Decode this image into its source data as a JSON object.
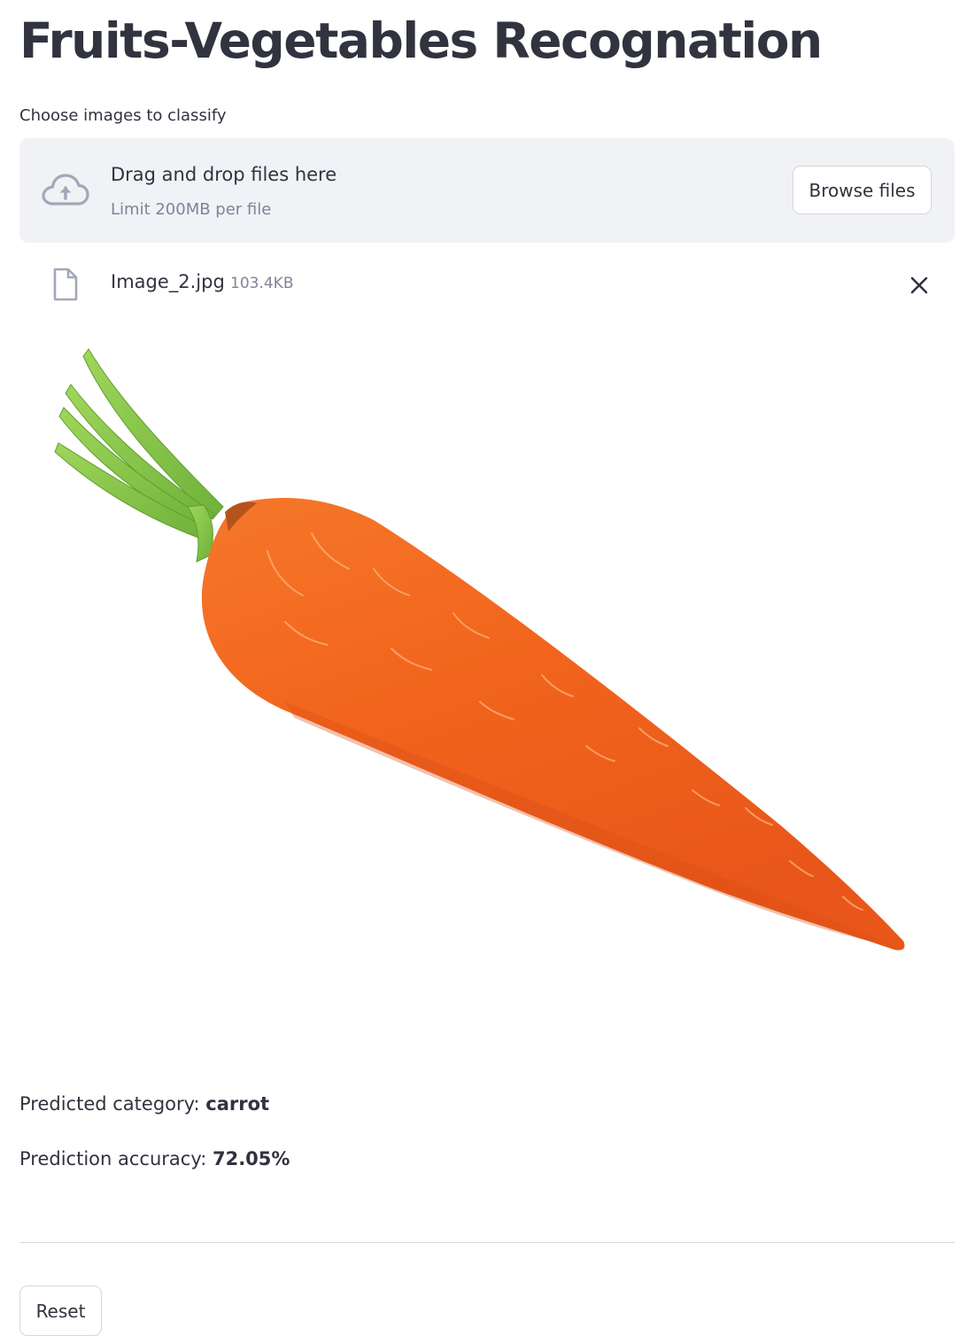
{
  "page": {
    "title": "Fruits-Vegetables Recognation"
  },
  "uploader": {
    "label": "Choose images to classify",
    "dropzone_title": "Drag and drop files here",
    "dropzone_limit": "Limit 200MB per file",
    "browse_label": "Browse files",
    "icon": "cloud-upload-icon"
  },
  "uploaded_file": {
    "name": "Image_2.jpg",
    "size": "103.4KB",
    "icon": "file-icon",
    "remove_icon": "close-icon"
  },
  "preview": {
    "subject": "carrot-image"
  },
  "result": {
    "category_label": "Predicted category: ",
    "category_value": "carrot",
    "accuracy_label": "Prediction accuracy: ",
    "accuracy_value": "72.05%"
  },
  "actions": {
    "reset_label": "Reset"
  },
  "colors": {
    "text": "#31333f",
    "muted": "#808495",
    "dropzone_bg": "#f0f2f6",
    "icon": "#a3a8b8",
    "carrot": "#f2651c",
    "leaves": "#8cc84b"
  }
}
